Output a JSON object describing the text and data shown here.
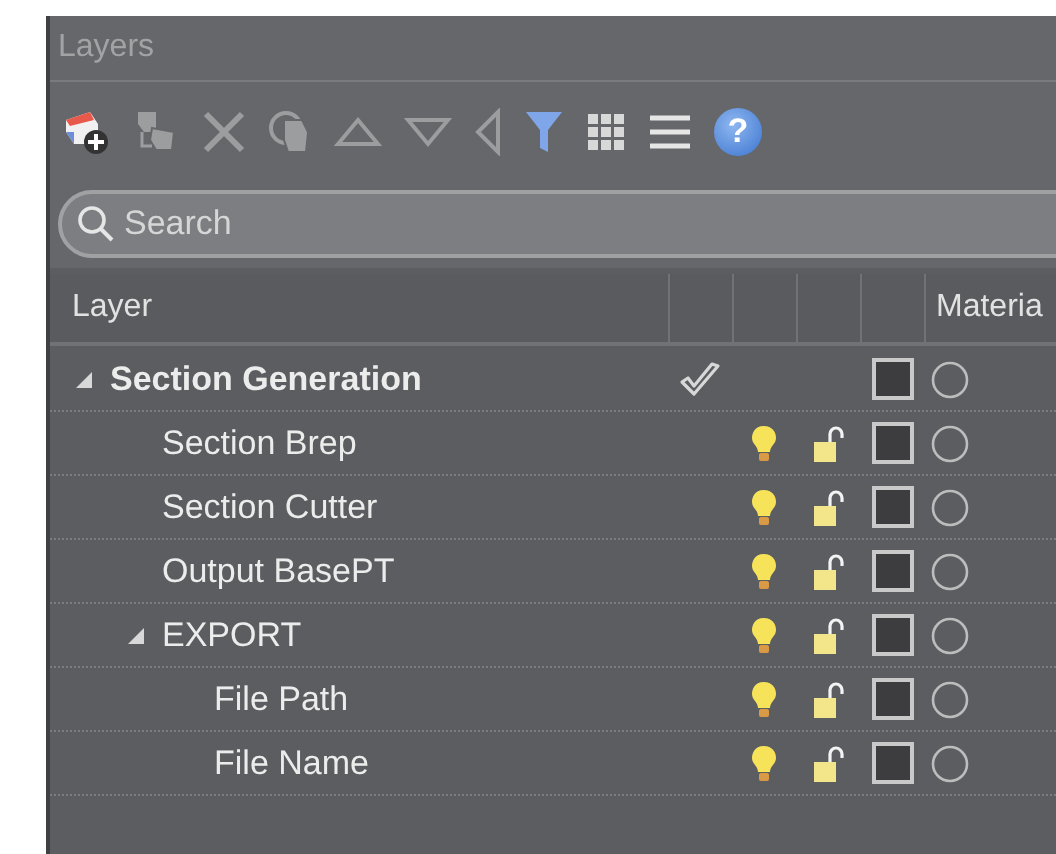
{
  "window": {
    "title": "Layers"
  },
  "toolbar": {
    "help_button": "?"
  },
  "search": {
    "placeholder": "Search"
  },
  "table": {
    "columns": {
      "name_column": "Layer",
      "material_column": "Materia"
    },
    "rows": [
      {
        "name": "Section Generation",
        "current": true,
        "expanded": true,
        "color": "#3d3d3f",
        "children": [
          {
            "name": "Section Brep",
            "current": false,
            "visible": true,
            "locked": false,
            "color": "#3d3d3f"
          },
          {
            "name": "Section Cutter",
            "current": false,
            "visible": true,
            "locked": false,
            "color": "#3d3d3f"
          },
          {
            "name": "Output BasePT",
            "current": false,
            "visible": true,
            "locked": false,
            "color": "#3d3d3f"
          },
          {
            "name": "EXPORT",
            "current": false,
            "visible": true,
            "locked": false,
            "expanded": true,
            "color": "#3d3d3f",
            "children": [
              {
                "name": "File Path",
                "current": false,
                "visible": true,
                "locked": false,
                "color": "#3d3d3f"
              },
              {
                "name": "File Name",
                "current": false,
                "visible": true,
                "locked": false,
                "color": "#3d3d3f"
              }
            ]
          }
        ]
      }
    ]
  }
}
